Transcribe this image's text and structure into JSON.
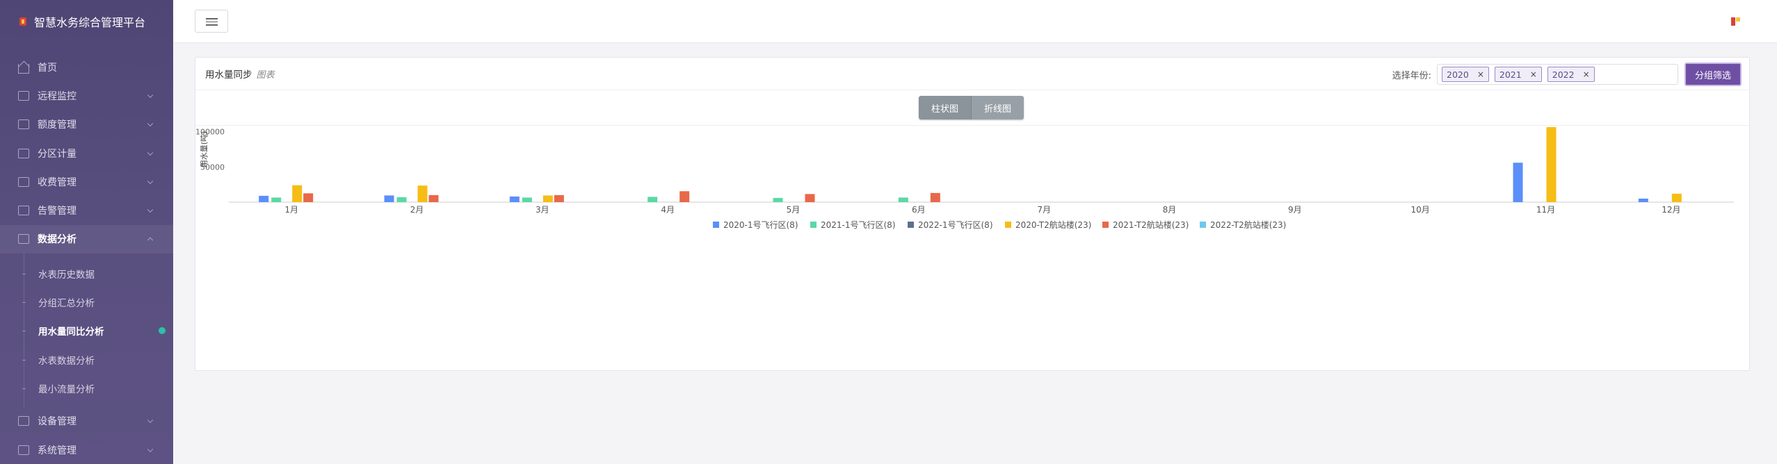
{
  "app": {
    "title": "智慧水务综合管理平台"
  },
  "sidebar": {
    "items": [
      {
        "label": "首页",
        "icon": "home-icon"
      },
      {
        "label": "远程监控",
        "icon": "monitor-icon"
      },
      {
        "label": "额度管理",
        "icon": "quota-icon"
      },
      {
        "label": "分区计量",
        "icon": "grid-icon"
      },
      {
        "label": "收费管理",
        "icon": "money-icon"
      },
      {
        "label": "告警管理",
        "icon": "alarm-icon"
      },
      {
        "label": "数据分析",
        "icon": "chart-icon"
      }
    ],
    "sub_items": [
      {
        "label": "水表历史数据"
      },
      {
        "label": "分组汇总分析"
      },
      {
        "label": "用水量同比分析"
      },
      {
        "label": "水表数据分析"
      },
      {
        "label": "最小流量分析"
      }
    ],
    "items_after": [
      {
        "label": "设备管理",
        "icon": "device-icon"
      },
      {
        "label": "系统管理",
        "icon": "settings-icon"
      }
    ]
  },
  "card": {
    "title": "用水量同步",
    "subtitle": "图表",
    "year_label": "选择年份:",
    "years": [
      "2020",
      "2021",
      "2022"
    ],
    "tag_remove": "×",
    "filter_button": "分组筛选",
    "view_buttons": {
      "bar": "柱状图",
      "line": "折线图"
    }
  },
  "colors": {
    "sidebar": "#54497b",
    "accent": "#6e4fa3",
    "series": [
      "#5b8ff9",
      "#5ad8a6",
      "#5d7092",
      "#f6bd16",
      "#e8684a",
      "#6dc8ec"
    ]
  },
  "chart_data": {
    "type": "bar",
    "title": "",
    "ylabel": "用水量(吨)",
    "xlabel": "",
    "ylim": [
      0,
      150000
    ],
    "yticks": [
      50000,
      100000,
      150000
    ],
    "categories": [
      "1月",
      "2月",
      "3月",
      "4月",
      "5月",
      "6月",
      "7月",
      "8月",
      "9月",
      "10月",
      "11月",
      "12月"
    ],
    "legend_position": "bottom",
    "grid": false,
    "series": [
      {
        "name": "2020-1号飞行区(8)",
        "values": [
          9000,
          9500,
          8000,
          0,
          0,
          0,
          0,
          0,
          0,
          0,
          56000,
          5000
        ]
      },
      {
        "name": "2021-1号飞行区(8)",
        "values": [
          6500,
          7000,
          6500,
          7500,
          6000,
          6500,
          0,
          0,
          0,
          0,
          0,
          0
        ]
      },
      {
        "name": "2022-1号飞行区(8)",
        "values": [
          0,
          0,
          0,
          0,
          0,
          0,
          0,
          0,
          0,
          0,
          0,
          0
        ]
      },
      {
        "name": "2020-T2航站楼(23)",
        "values": [
          24000,
          23500,
          9500,
          0,
          0,
          0,
          0,
          0,
          0,
          0,
          133000,
          12000
        ]
      },
      {
        "name": "2021-T2航站楼(23)",
        "values": [
          12500,
          10000,
          10000,
          15500,
          11500,
          13000,
          0,
          0,
          0,
          0,
          0,
          0
        ]
      },
      {
        "name": "2022-T2航站楼(23)",
        "values": [
          0,
          0,
          0,
          0,
          0,
          0,
          0,
          0,
          0,
          0,
          0,
          0
        ]
      }
    ]
  }
}
